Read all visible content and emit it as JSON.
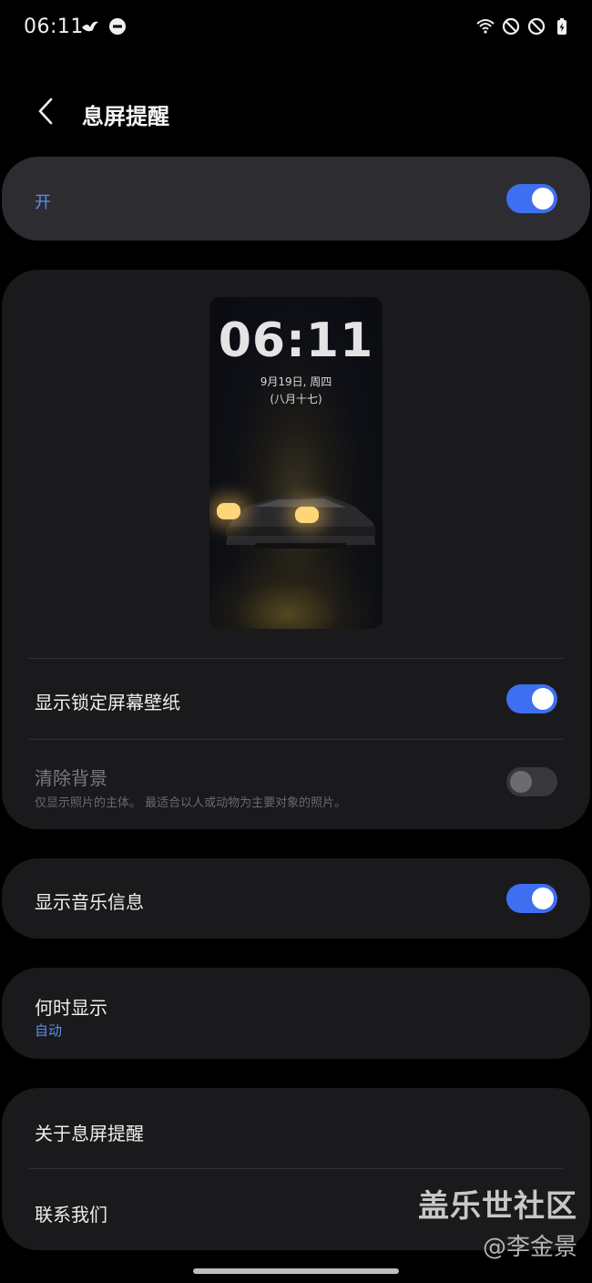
{
  "status_bar": {
    "time": "06:11",
    "left_icons": [
      "bird-icon",
      "do-not-disturb-icon"
    ],
    "right_icons": [
      "wifi-icon",
      "blocked-icon",
      "blocked-icon",
      "battery-charging-icon"
    ]
  },
  "header": {
    "title": "息屏提醒"
  },
  "master_switch": {
    "label": "开",
    "state": "on"
  },
  "preview": {
    "time": "06:11",
    "date": "9月19日, 周四",
    "lunar": "(八月十七)"
  },
  "settings": {
    "show_lock_wallpaper": {
      "label": "显示锁定屏幕壁纸",
      "state": "on"
    },
    "clear_background": {
      "label": "清除背景",
      "description": "仅显示照片的主体。 最适合以人或动物为主要对象的照片。",
      "state": "off"
    },
    "show_music_info": {
      "label": "显示音乐信息",
      "state": "on"
    },
    "when_to_show": {
      "label": "何时显示",
      "value": "自动"
    },
    "about": {
      "label": "关于息屏提醒"
    },
    "contact": {
      "label": "联系我们"
    }
  },
  "watermark": {
    "main": "盖乐世社区",
    "sub": "@李金景"
  },
  "colors": {
    "accent": "#3e6ff0",
    "link_text": "#5a8ff0",
    "card_bg": "#1a1a1d",
    "highlight_card_bg": "#2c2c31"
  }
}
